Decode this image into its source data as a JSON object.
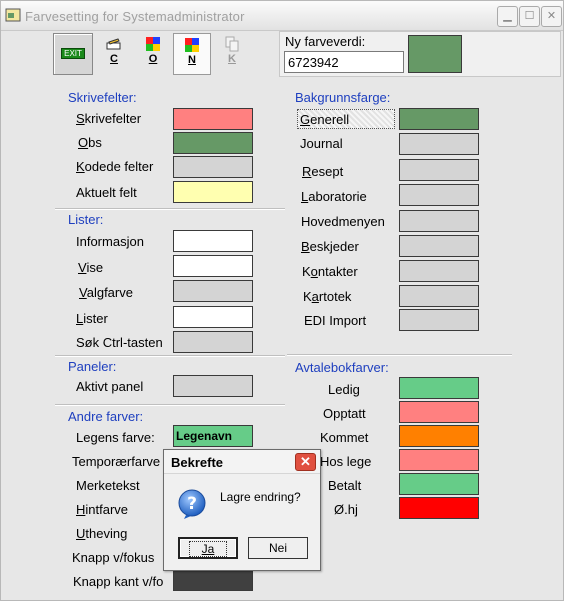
{
  "window": {
    "title": "Farvesetting for Systemadministrator"
  },
  "toolbar": {
    "exit_label": "EXIT",
    "buttons": [
      {
        "label": "C",
        "icon": "edit-icon"
      },
      {
        "label": "O",
        "icon": "palette-icon"
      },
      {
        "label": "N",
        "icon": "palette-icon"
      },
      {
        "label": "K",
        "icon": "copy-icon"
      }
    ]
  },
  "new_color": {
    "label": "Ny farveverdi:",
    "value": "6723942",
    "preview_color": "#669966"
  },
  "skrivefelter": {
    "title": "Skrivefelter:",
    "items": [
      {
        "label": "Skrivefelter",
        "color": "#ff8080"
      },
      {
        "label": "Obs",
        "color": "#669966"
      },
      {
        "label": "Kodede felter",
        "color": "#d4d4d4"
      },
      {
        "label": "Aktuelt felt",
        "color": "#ffffb0"
      }
    ]
  },
  "lister": {
    "title": "Lister:",
    "items": [
      {
        "label": "Informasjon",
        "color": "#ffffff"
      },
      {
        "label": "Vise",
        "color": "#ffffff"
      },
      {
        "label": "Valgfarve",
        "color": "#d4d4d4"
      },
      {
        "label": "Lister",
        "color": "#ffffff"
      },
      {
        "label": "Søk Ctrl-tasten",
        "color": "#d4d4d4"
      }
    ]
  },
  "paneler": {
    "title": "Paneler:",
    "items": [
      {
        "label": "Aktivt panel",
        "color": "#d4d4d4"
      }
    ]
  },
  "andre": {
    "title": "Andre farver:",
    "items": [
      {
        "label": "Legens farve:",
        "color": "#66cc88",
        "value": "Legenavn"
      },
      {
        "label": "Temporærfarve",
        "color": "#d4d4d4"
      },
      {
        "label": "Merketekst",
        "color": "#d4d4d4"
      },
      {
        "label": "Hintfarve",
        "color": "#d4d4d4"
      },
      {
        "label": "Utheving",
        "color": "#d4d4d4"
      },
      {
        "label": "Knapp v/fokus",
        "color": "#d4d4d4"
      },
      {
        "label": "Knapp kant v/fo",
        "color": "#404040"
      }
    ]
  },
  "bakgrunn": {
    "title": "Bakgrunnsfarge:",
    "items": [
      {
        "label": "Generell",
        "color": "#669966"
      },
      {
        "label": "Journal",
        "color": "#d4d4d4"
      },
      {
        "label": "Resept",
        "color": "#d4d4d4"
      },
      {
        "label": "Laboratorie",
        "color": "#d4d4d4"
      },
      {
        "label": "Hovedmenyen",
        "color": "#d4d4d4"
      },
      {
        "label": "Beskjeder",
        "color": "#d4d4d4"
      },
      {
        "label": "Kontakter",
        "color": "#d4d4d4"
      },
      {
        "label": "Kartotek",
        "color": "#d4d4d4"
      },
      {
        "label": "EDI Import",
        "color": "#d4d4d4"
      }
    ]
  },
  "avtalebok": {
    "title": "Avtalebokfarver:",
    "items": [
      {
        "label": "Ledig",
        "color": "#66cc88"
      },
      {
        "label": "Opptatt",
        "color": "#ff8080"
      },
      {
        "label": "Kommet",
        "color": "#ff8000"
      },
      {
        "label": "Hos lege",
        "color": "#ff8080"
      },
      {
        "label": "Betalt",
        "color": "#66cc88"
      },
      {
        "label": "Ø.hj",
        "color": "#ff0000"
      }
    ]
  },
  "dialog": {
    "title": "Bekrefte",
    "message": "Lagre endring?",
    "yes_label": "Ja",
    "no_label": "Nei"
  }
}
